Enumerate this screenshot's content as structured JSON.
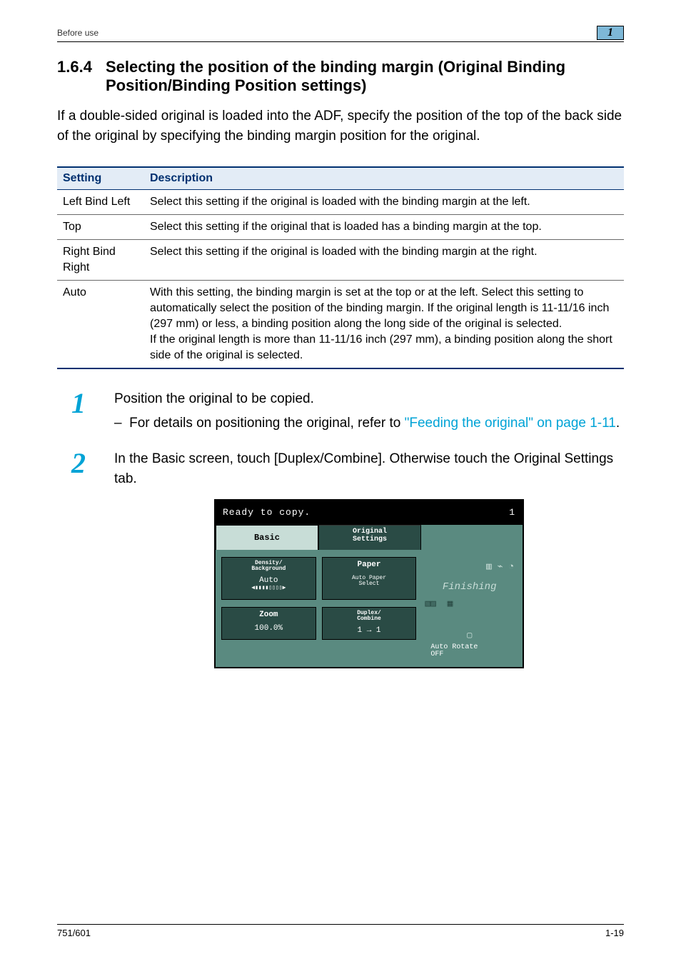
{
  "header": {
    "section": "Before use",
    "chapter_number": "1"
  },
  "section": {
    "number": "1.6.4",
    "title": "Selecting the position of the binding margin (Original Binding Position/Binding Position settings)"
  },
  "intro": "If a double-sided original is loaded into the ADF, specify the position of the top of the back side of the original by specifying the binding margin position for the original.",
  "table": {
    "headers": [
      "Setting",
      "Description"
    ],
    "rows": [
      {
        "setting": "Left Bind Left",
        "description": "Select this setting if the original is loaded with the binding margin at the left."
      },
      {
        "setting": "Top",
        "description": "Select this setting if the original that is loaded has a binding margin at the top."
      },
      {
        "setting": "Right Bind Right",
        "description": "Select this setting if the original is loaded with the binding margin at the right."
      },
      {
        "setting": "Auto",
        "description": "With this setting, the binding margin is set at the top or at the left. Select this setting to automatically select the position of the binding margin. If the original length is 11-11/16 inch (297 mm) or less, a binding position along the long side of the original is selected.\nIf the original length is more than 11-11/16 inch (297 mm), a binding position along the short side of the original is selected."
      }
    ]
  },
  "steps": {
    "1": {
      "body": "Position the original to be copied.",
      "bullet_pre": "For details on positioning the original, refer to ",
      "bullet_link": "\"Feeding the original\" on page 1-11",
      "bullet_post": "."
    },
    "2": {
      "body": "In the Basic screen, touch [Duplex/Combine]. Otherwise touch the Original Settings tab."
    }
  },
  "device": {
    "status_text": "Ready to copy.",
    "count": "1",
    "tabs": {
      "basic": "Basic",
      "original": "Original\nSettings"
    },
    "density": {
      "label": "Density/\nBackground",
      "value": "Auto"
    },
    "paper": {
      "label": "Paper",
      "value": "Auto Paper\nSelect"
    },
    "zoom": {
      "label": "Zoom",
      "value": "100.0%"
    },
    "duplex": {
      "label": "Duplex/\nCombine",
      "value": "1 → 1"
    },
    "finishing": "Finishing",
    "rotate": "Auto Rotate\nOFF"
  },
  "footer": {
    "model": "751/601",
    "page": "1-19"
  }
}
